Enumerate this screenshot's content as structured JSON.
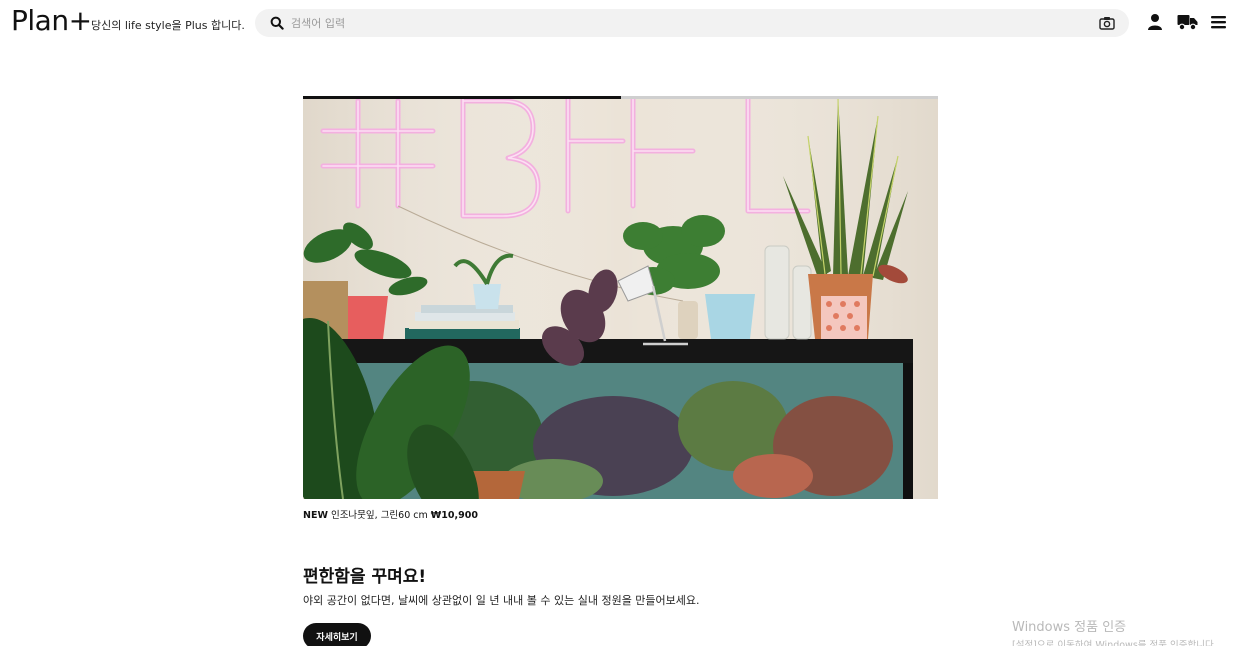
{
  "header": {
    "logo": "Plan+",
    "tagline": "당신의 life style을 Plus 합니다.",
    "search_placeholder": "검색어 입력",
    "icons": [
      "search-icon",
      "camera-icon",
      "user-icon",
      "truck-icon",
      "menu-icon"
    ]
  },
  "slider": {
    "progress_fraction": 0.5,
    "caption_badge": "NEW",
    "caption_text": "인조나뭇잎, 그린60 cm",
    "caption_price": "₩10,900"
  },
  "promo": {
    "heading": "편한함을 꾸며요!",
    "description": "야외 공간이 없다면, 날씨에 상관없이 일 년 내내 볼 수 있는 실내 정원을 만들어보세요.",
    "button_label": "자세히보기"
  },
  "os_watermark": {
    "line1": "Windows 정품 인증",
    "line2": "[설정]으로 이동하여 Windows를 정품 인증합니다."
  },
  "colors": {
    "text": "#111111",
    "search_bg": "#f2f2f2",
    "button_bg": "#111111",
    "wall": "#ece4d8",
    "neon": "#f2a8dc"
  }
}
